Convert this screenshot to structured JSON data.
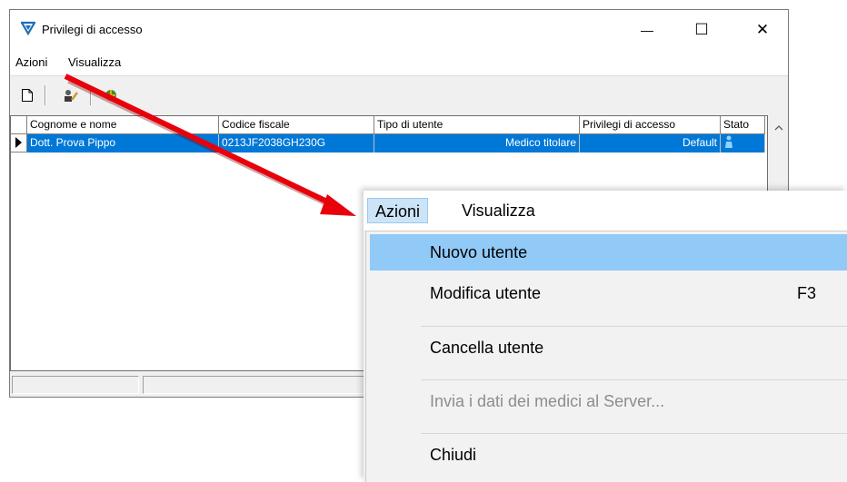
{
  "window": {
    "title": "Privilegi di accesso",
    "minimize_glyph": "—",
    "maximize_glyph": "☐",
    "close_glyph": "✕"
  },
  "menubar": {
    "items": [
      "Azioni",
      "Visualizza"
    ]
  },
  "toolbar": {
    "icons": [
      "new-document-icon",
      "edit-user-icon",
      "network-icon"
    ]
  },
  "grid": {
    "columns": [
      "Cognome e nome",
      "Codice fiscale",
      "Tipo di utente",
      "Privilegi di accesso",
      "Stato"
    ],
    "rows": [
      {
        "nome": "Dott. Prova Pippo",
        "codice": "0213JF2038GH230G",
        "tipo": "Medico titolare",
        "privilegi": "Default",
        "stato_icon": "user-icon"
      }
    ]
  },
  "zoom_menu": {
    "menubar": [
      "Azioni",
      "Visualizza"
    ],
    "items": [
      {
        "label": "Nuovo utente",
        "shortcut": ""
      },
      {
        "label": "Modifica utente",
        "shortcut": "F3"
      },
      {
        "label": "Cancella utente",
        "shortcut": ""
      },
      {
        "label": "Invia i dati dei medici al Server...",
        "shortcut": ""
      },
      {
        "label": "Chiudi",
        "shortcut": ""
      }
    ]
  },
  "colors": {
    "selection": "#0078d7",
    "menu_highlight": "#91c9f7",
    "arrow": "#e8000b"
  }
}
